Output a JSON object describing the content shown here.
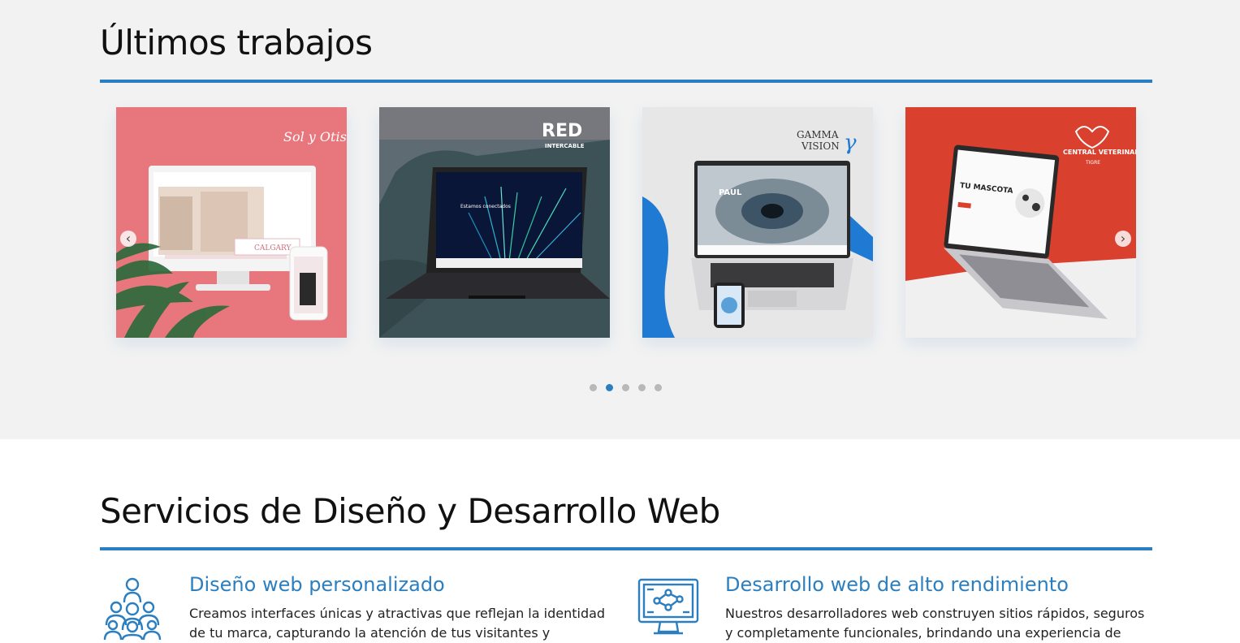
{
  "works": {
    "title": "Últimos trabajos",
    "cards": [
      {
        "brand": "Sol y Otis",
        "screen_text": "CALGARY"
      },
      {
        "brand": "RED",
        "brand_sub": "INTERCABLE",
        "screen_text": "Estamos conectados"
      },
      {
        "brand": "GAMMA",
        "brand_sub": "VISION",
        "screen_text": "PAUL"
      },
      {
        "brand": "CENTRAL VETERINARIA",
        "brand_sub": "TIGRE",
        "screen_text": "TU MASCOTA"
      }
    ],
    "prev_icon": "chevron-left-icon",
    "next_icon": "chevron-right-icon",
    "dots": 5,
    "active_dot": 2
  },
  "services": {
    "title": "Servicios de Diseño y Desarrollo Web",
    "items": [
      {
        "icon": "team-people-icon",
        "title": "Diseño web personalizado",
        "text": "Creamos interfaces únicas y atractivas que reflejan la identidad de tu marca, capturando la atención de tus visitantes y"
      },
      {
        "icon": "monitor-network-icon",
        "title": "Desarrollo web de alto rendimiento",
        "text": "Nuestros desarrolladores web construyen sitios rápidos, seguros y completamente funcionales, brindando una experiencia de"
      }
    ]
  },
  "colors": {
    "accent": "#2b7fc0",
    "section_bg": "#f2f2f2"
  }
}
